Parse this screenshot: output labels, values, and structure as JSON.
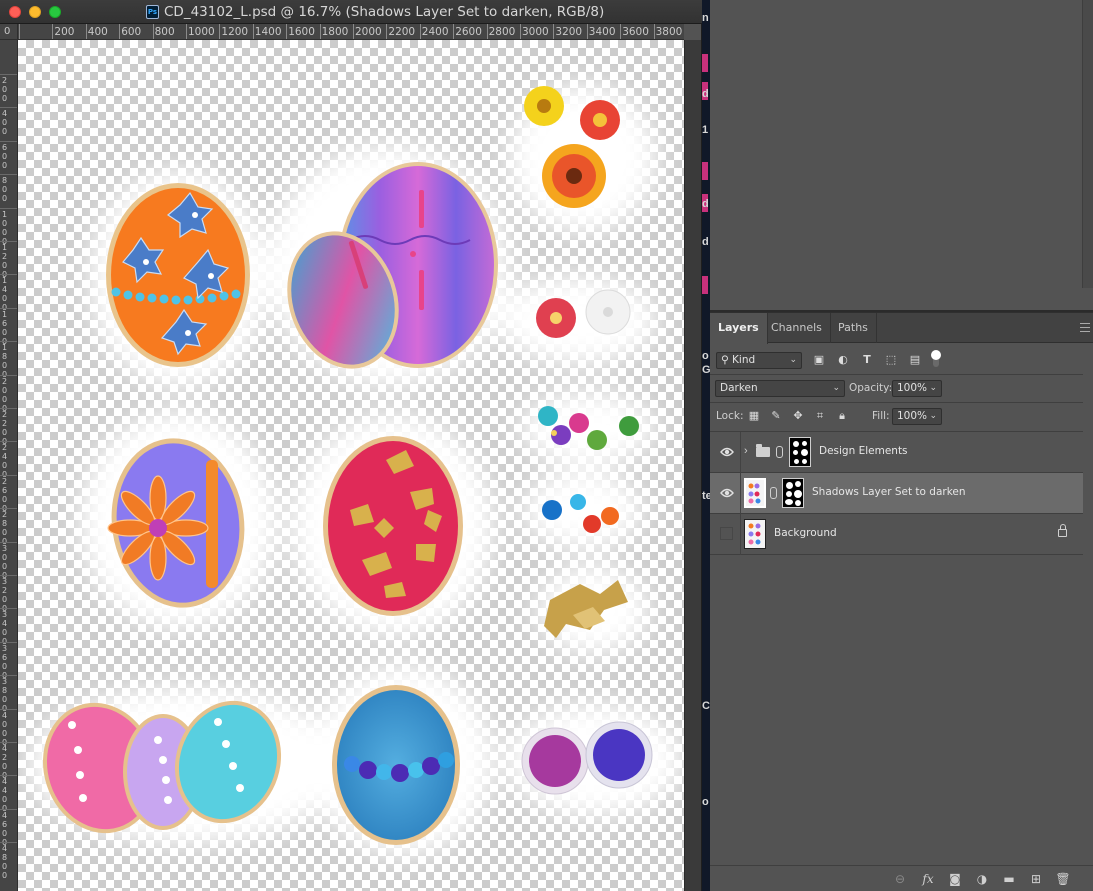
{
  "document": {
    "title": "CD_43102_L.psd @ 16.7% (Shadows Layer Set to darken, RGB/8)",
    "app_badge": "Ps",
    "ruler_corner": "0",
    "ruler_labels": [
      "200",
      "400",
      "600",
      "800",
      "1000",
      "1200",
      "1400",
      "1600",
      "1800",
      "2000",
      "2200",
      "2400",
      "2600",
      "2800",
      "3000",
      "3200",
      "3400",
      "3600",
      "3800"
    ],
    "vertical_ruler_labels": [
      "2 0 0",
      "4 0 0",
      "6 0 0",
      "8 0 0",
      "1 0 0 0",
      "1 2 0 0",
      "1 4 0 0",
      "1 6 0 0",
      "1 8 0 0",
      "2 0 0 0",
      "2 2 0 0",
      "2 4 0 0",
      "2 6 0 0",
      "2 8 0 0",
      "3 0 0 0",
      "3 2 0 0",
      "3 4 0 0",
      "3 6 0 0",
      "3 8 0 0",
      "4 0 0 0",
      "4 2 0 0",
      "4 4 0 0",
      "4 6 0 0",
      "4 8 0 0"
    ]
  },
  "side_strip_chars": [
    "n",
    "d",
    "1",
    "d",
    "d",
    "o",
    "G",
    "te",
    "o",
    "C"
  ],
  "layers_panel": {
    "tabs": [
      {
        "label": "Layers",
        "active": true
      },
      {
        "label": "Channels",
        "active": false
      },
      {
        "label": "Paths",
        "active": false
      }
    ],
    "filter": {
      "kind_label": "Kind"
    },
    "blend_mode": "Darken",
    "opacity_label": "Opacity:",
    "opacity_value": "100%",
    "lock_label": "Lock:",
    "fill_label": "Fill:",
    "fill_value": "100%",
    "layers": [
      {
        "name": "Design Elements",
        "type": "group",
        "visible": true,
        "selected": false
      },
      {
        "name": "Shadows Layer Set to darken",
        "type": "layer",
        "visible": true,
        "selected": true
      },
      {
        "name": "Background",
        "type": "background",
        "visible": false,
        "selected": false,
        "locked": true
      }
    ],
    "bottom_icons": [
      "link-layers-icon",
      "fx-icon",
      "add-mask-icon",
      "adjustment-layer-icon",
      "new-group-icon",
      "new-layer-icon",
      "delete-layer-icon"
    ],
    "fx_label": "fx"
  }
}
